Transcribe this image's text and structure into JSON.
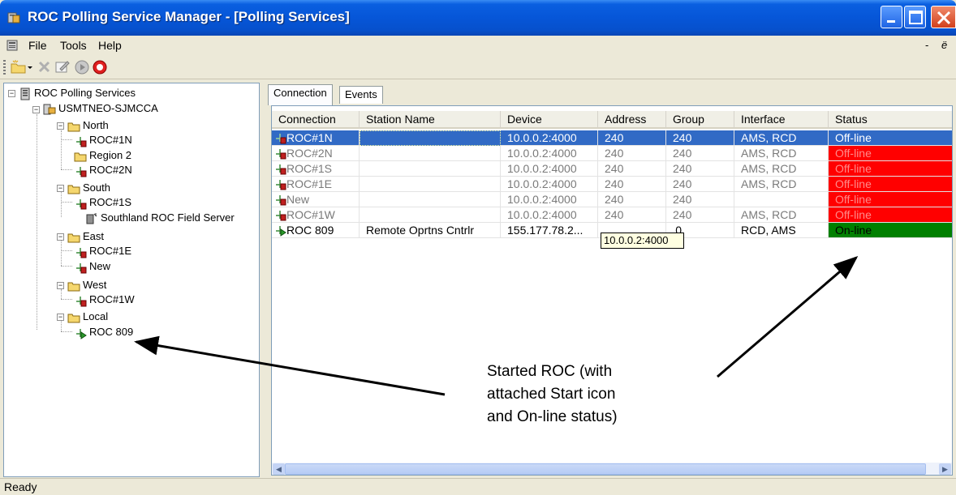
{
  "window": {
    "title": "ROC Polling Service Manager - [Polling Services]",
    "title_bar_color": "#0656d8"
  },
  "menu": {
    "items": [
      {
        "label": "File"
      },
      {
        "label": "Tools"
      },
      {
        "label": "Help"
      }
    ],
    "mdi_controls": [
      "-",
      "ё"
    ]
  },
  "toolbar": {
    "buttons": [
      "new-folder-icon",
      "dropdown-arrow-icon",
      "delete-icon",
      "edit-icon",
      "start-icon",
      "stop-icon"
    ]
  },
  "tree": {
    "root": "ROC Polling Services",
    "server": "USMTNEO-SJMCCA",
    "nodes": [
      {
        "label": "North"
      },
      {
        "label": "ROC#1N"
      },
      {
        "label": "Region 2"
      },
      {
        "label": "ROC#2N"
      },
      {
        "label": "South"
      },
      {
        "label": "ROC#1S"
      },
      {
        "label": "Southland ROC Field Server"
      },
      {
        "label": "East"
      },
      {
        "label": "ROC#1E"
      },
      {
        "label": "New"
      },
      {
        "label": "West"
      },
      {
        "label": "ROC#1W"
      },
      {
        "label": "Local"
      },
      {
        "label": "ROC 809"
      }
    ]
  },
  "tabs": [
    {
      "label": "Connection"
    },
    {
      "label": "Events"
    }
  ],
  "grid": {
    "columns": [
      "Connection",
      "Station Name",
      "Device",
      "Address",
      "Group",
      "Interface",
      "Status"
    ],
    "rows": [
      {
        "connection": "ROC#1N",
        "station": "",
        "device": "10.0.0.2:4000",
        "address": "240",
        "group": "240",
        "interface": "AMS, RCD",
        "status": "Off-line"
      },
      {
        "connection": "ROC#2N",
        "station": "",
        "device": "10.0.0.2:4000",
        "address": "240",
        "group": "240",
        "interface": "AMS, RCD",
        "status": "Off-line"
      },
      {
        "connection": "ROC#1S",
        "station": "",
        "device": "10.0.0.2:4000",
        "address": "240",
        "group": "240",
        "interface": "AMS, RCD",
        "status": "Off-line"
      },
      {
        "connection": "ROC#1E",
        "station": "",
        "device": "10.0.0.2:4000",
        "address": "240",
        "group": "240",
        "interface": "AMS, RCD",
        "status": "Off-line"
      },
      {
        "connection": "New",
        "station": "",
        "device": "10.0.0.2:4000",
        "address": "240",
        "group": "240",
        "interface": "",
        "status": "Off-line"
      },
      {
        "connection": "ROC#1W",
        "station": "",
        "device": "10.0.0.2:4000",
        "address": "240",
        "group": "240",
        "interface": "AMS, RCD",
        "status": "Off-line"
      },
      {
        "connection": "ROC 809",
        "station": "Remote Oprtns Cntrlr",
        "device": "155.177.78.2...",
        "address": "",
        "group": "0",
        "interface": "RCD, AMS",
        "status": "On-line"
      }
    ],
    "tooltip": "10.0.0.2:4000",
    "status_colors": {
      "offline": "#ff0000",
      "online": "#008000",
      "selected": "#316ac5"
    }
  },
  "statusbar": {
    "text": "Ready"
  },
  "annotation": {
    "lines": [
      "Started ROC (with",
      "attached Start icon",
      "and On-line status)"
    ]
  }
}
